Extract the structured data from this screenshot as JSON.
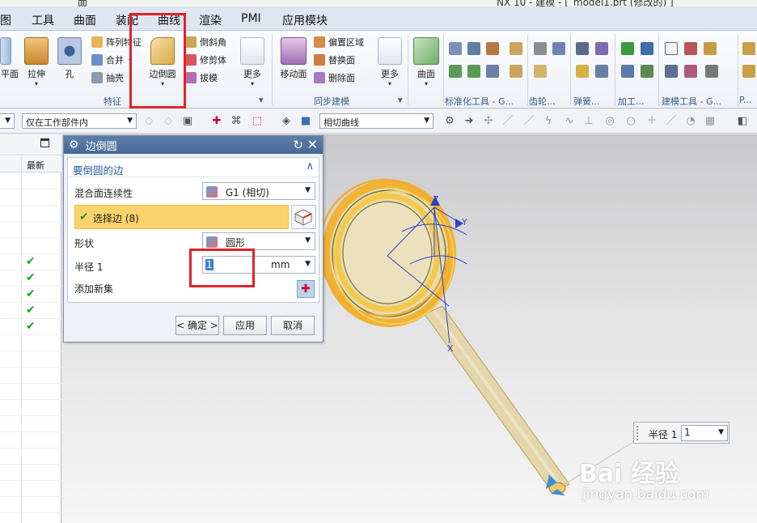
{
  "title": {
    "left": "面",
    "right": "NX 10 - 建模 - [_model1.prt  (修改的) ]"
  },
  "menu": [
    "图",
    "工具",
    "曲面",
    "装配",
    "曲线",
    "渲染",
    "PMI",
    "应用模块"
  ],
  "ribbon": {
    "plane": "平面",
    "extrude": "拉伸",
    "hole": "孔",
    "pattern_feature": "阵列特征",
    "unite": "合并",
    "shell": "抽壳",
    "edge_blend": "边倒圆",
    "chamfer": "倒斜角",
    "trim_body": "修剪体",
    "draft": "拔模",
    "more1": "更多",
    "move_face": "移动面",
    "offset_region": "偏置区域",
    "replace_face": "替换面",
    "delete_face": "删除面",
    "more2": "更多",
    "surface": "曲面",
    "group_feature": "特征",
    "group_sync": "同步建模",
    "group_std": "标准化工具 - G...",
    "group_gear": "齿轮...",
    "group_spring": "弹簧...",
    "group_machining": "加工...",
    "group_build": "建模工具 - G...",
    "group_p": "P..."
  },
  "toolbar2": {
    "filter_value": "仅在工作部件内",
    "curve_rule": "相切曲线"
  },
  "left_panel": {
    "column_header": "最新",
    "check_mark": "✔"
  },
  "dialog": {
    "title": "边倒圆",
    "section_title": "要倒圆的边",
    "continuity_label": "混合面连续性",
    "continuity_value": "G1 (相切)",
    "select_edge": "选择边 (8)",
    "shape_label": "形状",
    "shape_value": "圆形",
    "radius_label": "半径 1",
    "radius_value": "1",
    "radius_unit": "mm",
    "add_new_set": "添加新集",
    "ok": "< 确定 >",
    "apply": "应用",
    "cancel": "取消"
  },
  "viewport": {
    "axis_z": "Z",
    "axis_y": "Y",
    "axis_x": "X",
    "float_label": "半径 1",
    "float_value": "1",
    "watermark_main": "Bai 经验",
    "watermark_url": "jingyan.baidu.com"
  },
  "colors": {
    "highlight_red": "#e3222b",
    "selection_orange": "#fbd36c",
    "dialog_title": "#4f71a0",
    "model_tan": "#e2d3a4"
  }
}
